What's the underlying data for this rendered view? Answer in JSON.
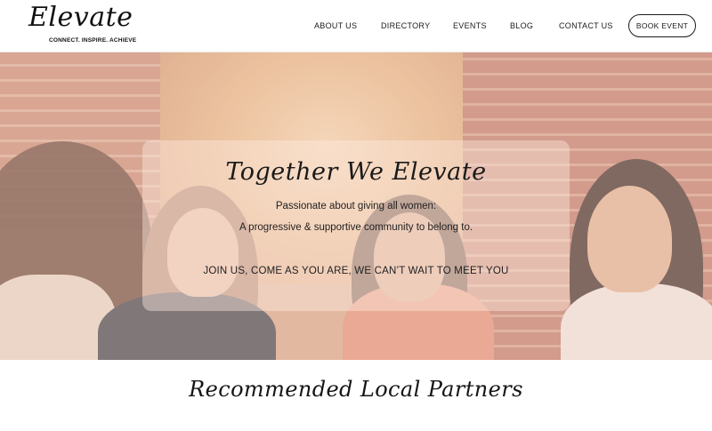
{
  "logo": {
    "name": "Elevate",
    "tagline": "CONNECT. INSPIRE. ACHIEVE"
  },
  "nav": {
    "items": [
      {
        "label": "ABOUT US"
      },
      {
        "label": "DIRECTORY"
      },
      {
        "label": "EVENTS"
      },
      {
        "label": "BLOG"
      },
      {
        "label": "CONTACT US"
      }
    ],
    "book_label": "BOOK EVENT"
  },
  "hero": {
    "title": "Together We Elevate",
    "line1": "Passionate about giving all women:",
    "line2": "A progressive & supportive community to belong to.",
    "cta": "JOIN US, COME AS YOU ARE, WE CAN’T WAIT TO MEET YOU"
  },
  "partners": {
    "title": "Recommended Local Partners"
  },
  "colors": {
    "text": "#1b1b1b",
    "hero_overlay": "#f2d6c8",
    "background": "#ffffff"
  }
}
